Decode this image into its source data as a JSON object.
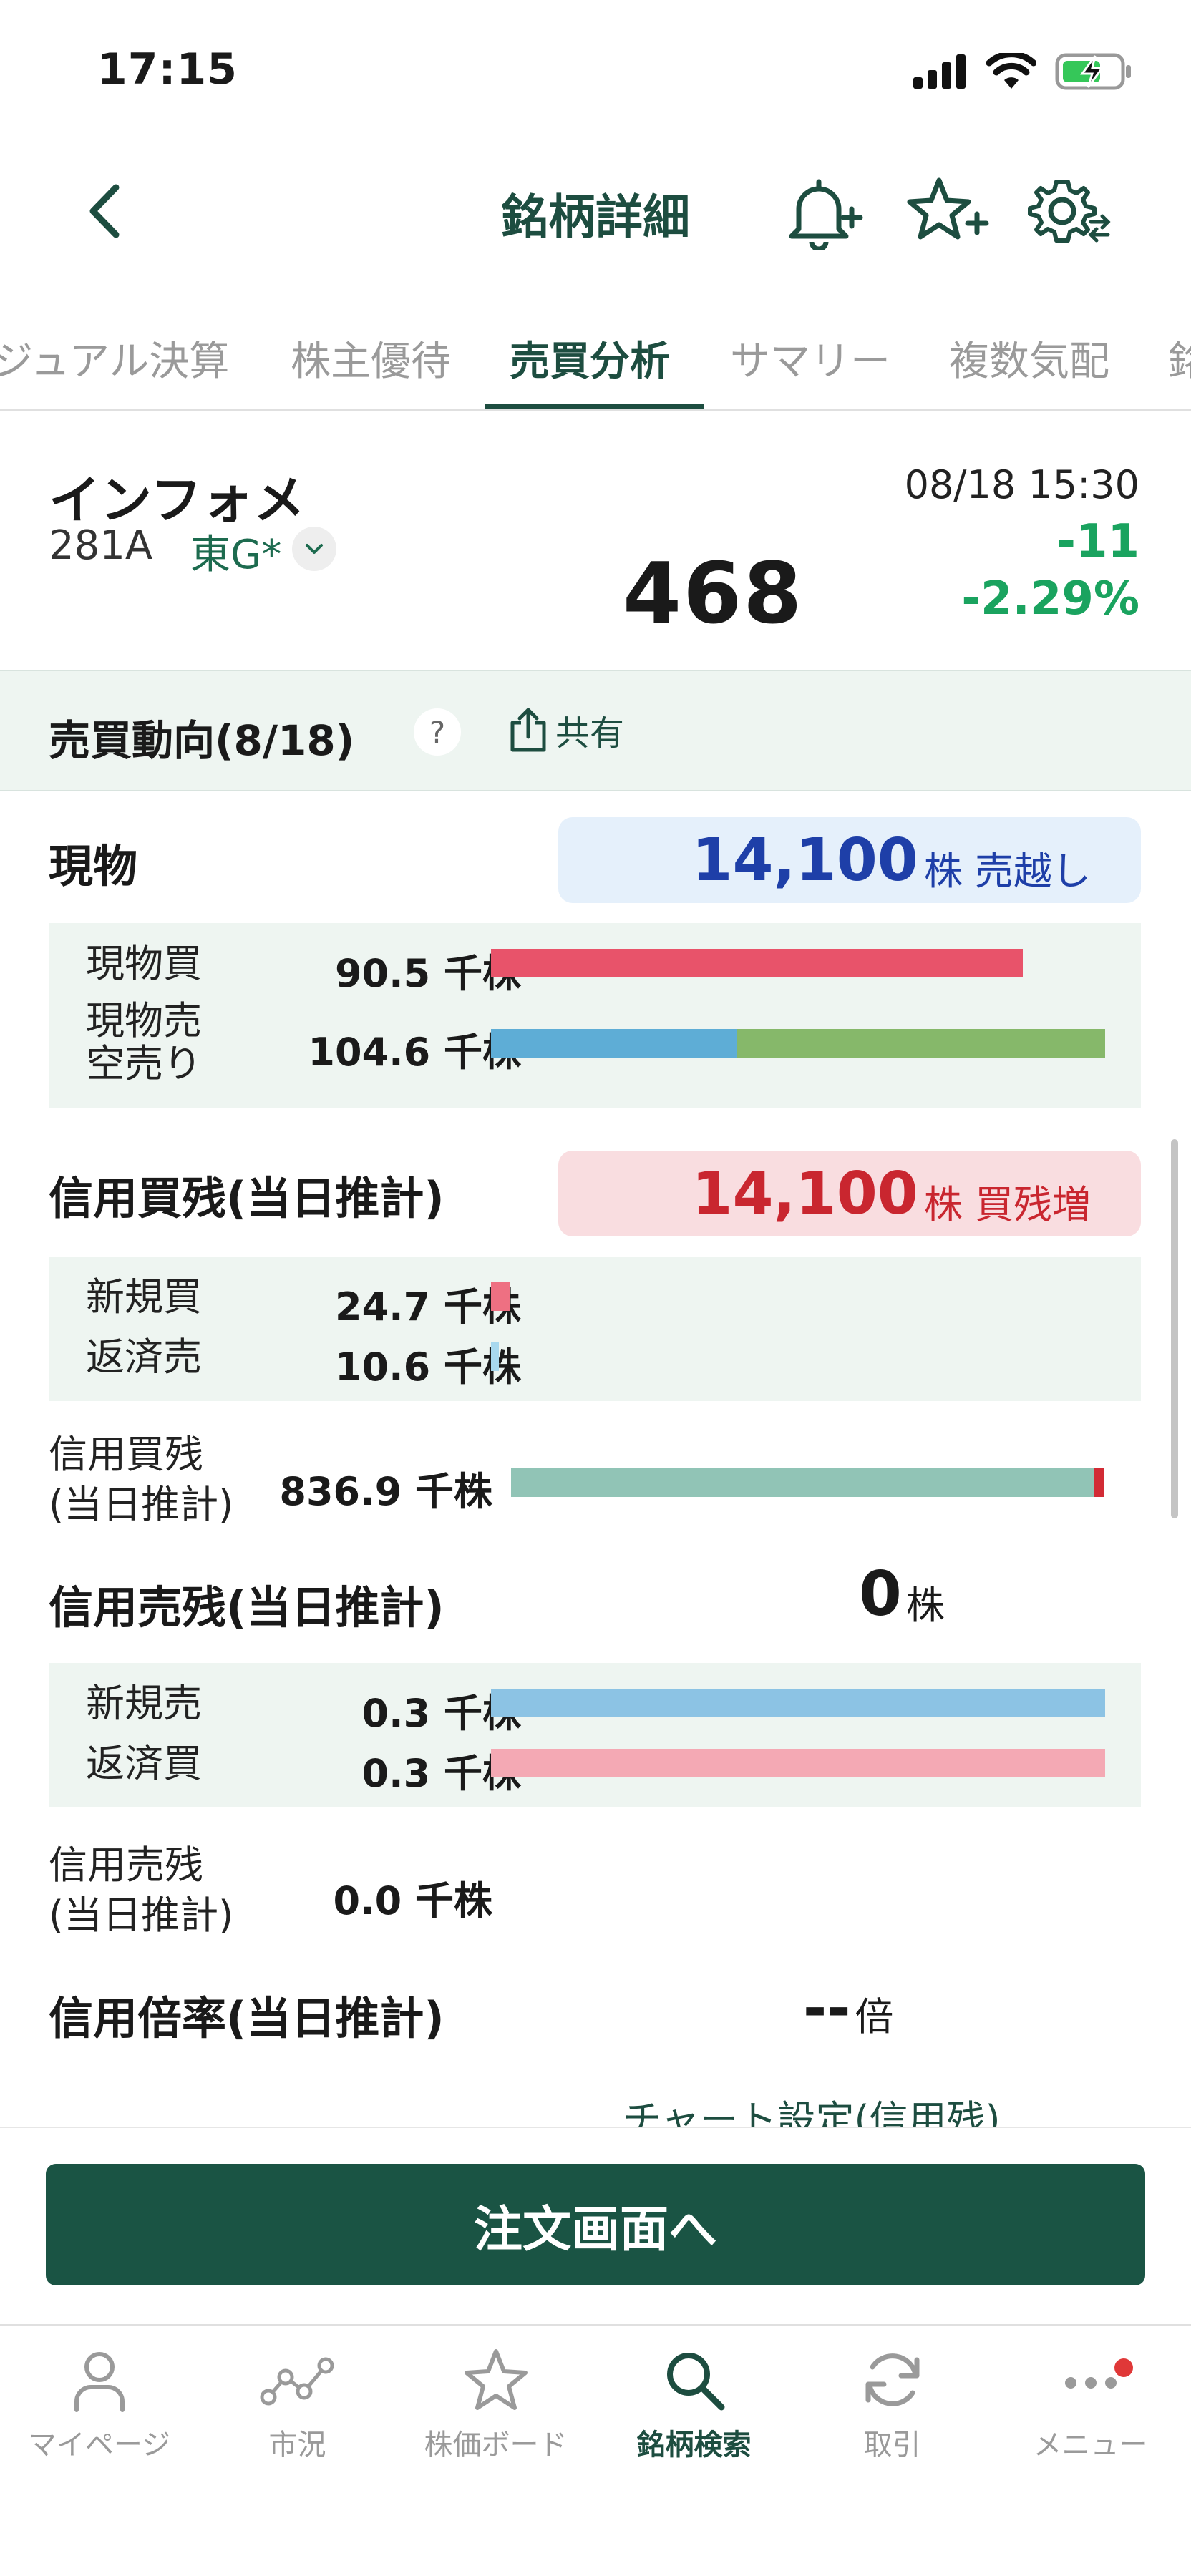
{
  "status_bar": {
    "time": "17:15"
  },
  "nav": {
    "title": "銘柄詳細"
  },
  "tabs": [
    {
      "label": "ジュアル決算"
    },
    {
      "label": "株主優待"
    },
    {
      "label": "売買分析"
    },
    {
      "label": "サマリー"
    },
    {
      "label": "複数気配"
    },
    {
      "label": "銘"
    }
  ],
  "stock": {
    "name": "インフォメ",
    "code": "281A",
    "market": "東G*",
    "price": "468",
    "datetime": "08/18 15:30",
    "change": "-11",
    "change_pct": "-2.29%"
  },
  "trend": {
    "title": "売買動向(8/18)",
    "help": "?",
    "share_label": "共有"
  },
  "genbutsu": {
    "title": "現物",
    "summary_value": "14,100",
    "summary_unit": "株 売越し",
    "buy_label": "現物買",
    "buy_value": "90.5 千株",
    "sell_label_1": "現物売",
    "sell_label_2": "空売り",
    "sell_value": "104.6 千株",
    "buy_ratio": 0.866,
    "sell_part_ratio": 0.4,
    "short_part_ratio": 0.6
  },
  "margin_buy": {
    "title": "信用買残(当日推計)",
    "summary_value": "14,100",
    "summary_unit": "株 買残増",
    "new_label": "新規買",
    "new_value": "24.7 千株",
    "repay_label": "返済売",
    "repay_value": "10.6 千株",
    "balance_label_1": "信用買残",
    "balance_label_2": "(当日推計)",
    "balance_value": "836.9 千株",
    "new_ratio": 0.03,
    "repay_ratio": 0.013,
    "increase_ratio": 0.017
  },
  "margin_sell": {
    "title": "信用売残(当日推計)",
    "summary_value": "0",
    "summary_unit": "株",
    "new_label": "新規売",
    "new_value": "0.3 千株",
    "repay_label": "返済買",
    "repay_value": "0.3 千株",
    "balance_label_1": "信用売残",
    "balance_label_2": "(当日推計)",
    "balance_value": "0.0 千株",
    "new_ratio": 1.0,
    "repay_ratio": 1.0
  },
  "margin_ratio": {
    "title": "信用倍率(当日推計)",
    "value": "--",
    "unit": "倍"
  },
  "chart_setting": {
    "label": "チャート設定(信用残)"
  },
  "order": {
    "label": "注文画面へ"
  },
  "tabbar": [
    {
      "label": "マイページ"
    },
    {
      "label": "市況"
    },
    {
      "label": "株価ボード"
    },
    {
      "label": "銘柄検索"
    },
    {
      "label": "取引"
    },
    {
      "label": "メニュー"
    }
  ],
  "colors": {
    "brand": "#1a5444",
    "buy": "#e8536a",
    "sell": "#5eadd6",
    "short": "#86b86a",
    "new_buy": "#ee7082",
    "repay_sell": "#a8d8ee",
    "balance": "#91c4b6",
    "balance_inc": "#d22b35",
    "new_sell": "#8cc3e4",
    "repay_buy": "#f4a9b4",
    "up": "#1aa35f"
  }
}
